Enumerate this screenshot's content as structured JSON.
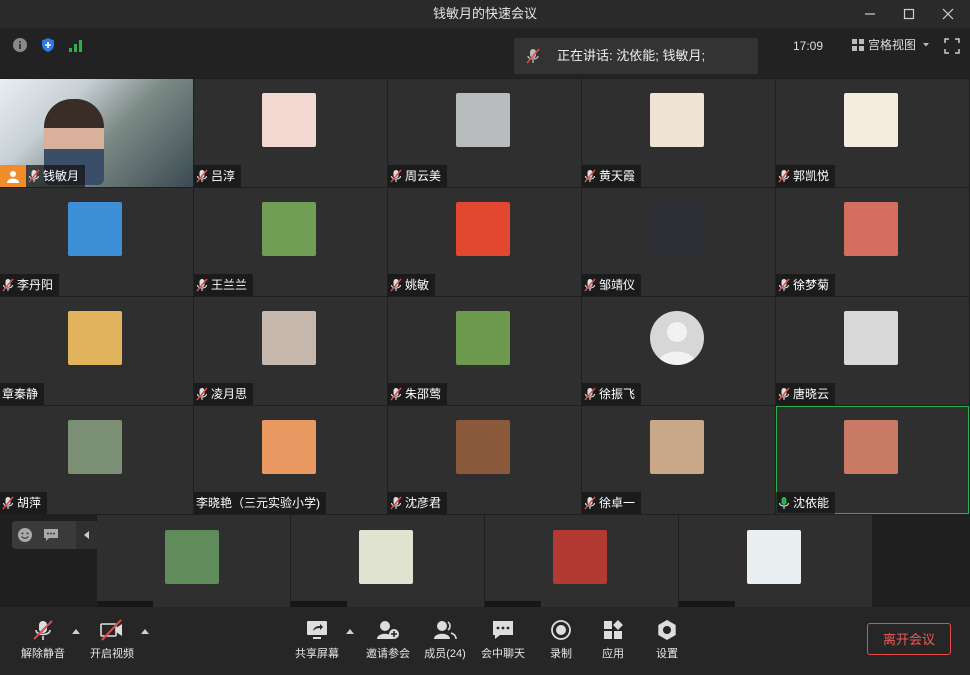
{
  "window": {
    "title": "钱敏月的快速会议"
  },
  "topbar": {
    "speaking_prefix": "正在讲话:",
    "speaking_names": "沈依能; 钱敏月;",
    "time": "17:09",
    "view_mode": "宫格视图"
  },
  "participants": [
    {
      "name": "钱敏月",
      "host": true,
      "video": true
    },
    {
      "name": "吕淳",
      "avatar_color": "#f3d9d2"
    },
    {
      "name": "周云美",
      "avatar_color": "#b9bcbc"
    },
    {
      "name": "黄天霞",
      "avatar_color": "#efe4d4"
    },
    {
      "name": "郭凯悦",
      "avatar_color": "#f5ece0"
    },
    {
      "name": "李丹阳",
      "avatar_color": "#3d8fd6"
    },
    {
      "name": "王兰兰",
      "avatar_color": "#6f9e54"
    },
    {
      "name": "姚敏",
      "avatar_color": "#e2472f"
    },
    {
      "name": "邹靖仪",
      "avatar_color": "#2e2f35"
    },
    {
      "name": "徐梦菊",
      "avatar_color": "#d46f5f"
    },
    {
      "name": "章秦静",
      "avatar_color": "#e1b35d",
      "no_mic": true
    },
    {
      "name": "凌月思",
      "avatar_color": "#c6b8ad"
    },
    {
      "name": "朱邵莺",
      "avatar_color": "#6d9a4f"
    },
    {
      "name": "徐振飞",
      "avatar_color": "#d7d7d7",
      "default_avatar": true
    },
    {
      "name": "唐晓云",
      "avatar_color": "#d9d9d9"
    },
    {
      "name": "胡萍",
      "avatar_color": "#7a8f74"
    },
    {
      "name": "李晓艳（三元实验小学)",
      "avatar_color": "#e99a62",
      "no_mic": true
    },
    {
      "name": "沈彦君",
      "avatar_color": "#8b5a3c"
    },
    {
      "name": "徐卓一",
      "avatar_color": "#c9a889"
    },
    {
      "name": "沈依能",
      "avatar_color": "#c97a65",
      "active": true,
      "mic_on": true
    }
  ],
  "strip": [
    {
      "avatar_color": "#5f8c5a"
    },
    {
      "avatar_color": "#dfe3d0"
    },
    {
      "avatar_color": "#b23a32"
    },
    {
      "avatar_color": "#e9eef0"
    }
  ],
  "toolbar": {
    "unmute": "解除静音",
    "start_video": "开启视频",
    "share_screen": "共享屏幕",
    "invite": "邀请参会",
    "members": "成员(24)",
    "chat": "会中聊天",
    "record": "录制",
    "apps": "应用",
    "settings": "设置",
    "leave": "离开会议"
  },
  "colors": {
    "accent_green": "#2bb04e",
    "leave_red": "#e84b4b",
    "host_orange": "#f08c2c"
  }
}
